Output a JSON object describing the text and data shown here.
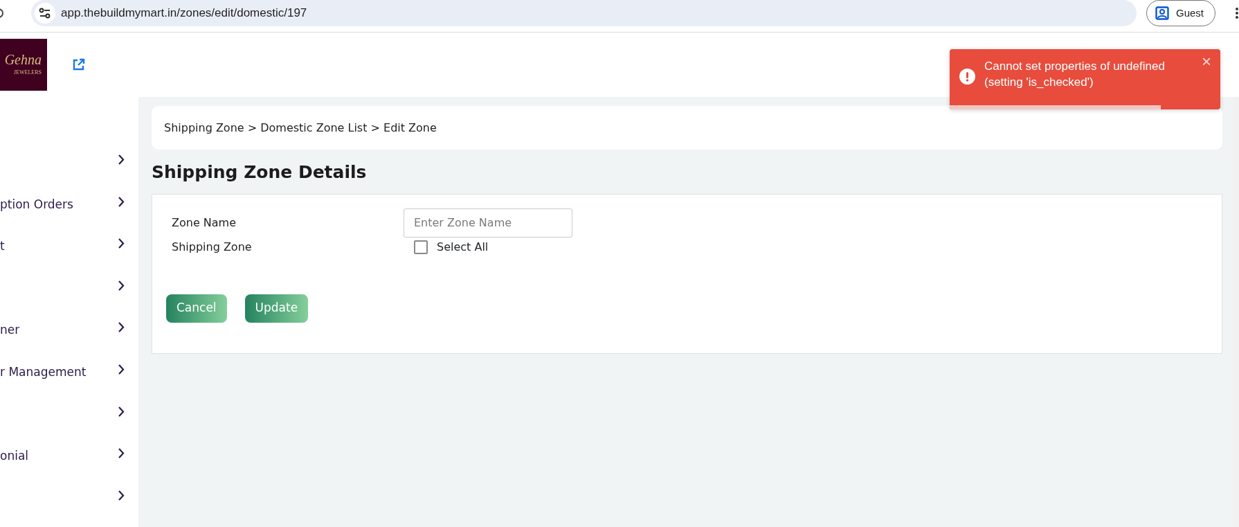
{
  "browser": {
    "url": "app.thebuildmymart.in/zones/edit/domestic/197",
    "profile": "Guest"
  },
  "header": {
    "logo_text": "Gehna",
    "logo_subtext": "JEWELERS"
  },
  "sidebar": {
    "items": [
      {
        "kind": "chevron"
      },
      {
        "kind": "labelled",
        "label": "ption Orders"
      },
      {
        "kind": "labelled",
        "label": "t"
      },
      {
        "kind": "chevron"
      },
      {
        "kind": "labelled",
        "label": "ner"
      },
      {
        "kind": "labelled",
        "label": "r Management"
      },
      {
        "kind": "chevron"
      },
      {
        "kind": "labelled",
        "label": "onial"
      },
      {
        "kind": "chevron"
      }
    ]
  },
  "breadcrumb": [
    "Shipping Zone",
    "Domestic Zone List",
    "Edit Zone"
  ],
  "breadcrumb_separator": ">",
  "page_title": "Shipping Zone Details",
  "form": {
    "fields": [
      {
        "kind": "text",
        "label": "Zone Name",
        "placeholder": "Enter Zone Name"
      },
      {
        "kind": "checkbox",
        "label": "Shipping Zone",
        "option": "Select All",
        "checked": false
      }
    ],
    "buttons": [
      "Cancel",
      "Update"
    ]
  },
  "toast": {
    "message": "Cannot set properties of undefined (setting 'is_checked')",
    "close": "×",
    "level": 0.78
  }
}
